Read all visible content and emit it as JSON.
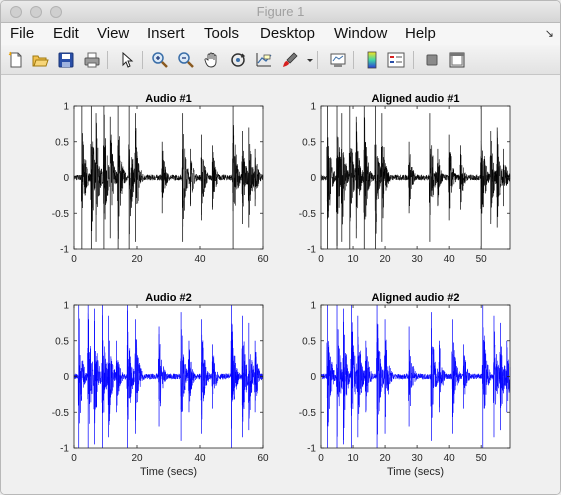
{
  "window": {
    "title": "Figure 1"
  },
  "menu": {
    "file": "File",
    "edit": "Edit",
    "view": "View",
    "insert": "Insert",
    "tools": "Tools",
    "desktop": "Desktop",
    "window": "Window",
    "help": "Help"
  },
  "toolbar": {
    "icons": [
      "new-figure-icon",
      "open-file-icon",
      "save-icon",
      "print-icon",
      "pointer-icon",
      "zoom-in-icon",
      "zoom-out-icon",
      "pan-icon",
      "rotate-3d-icon",
      "data-cursor-icon",
      "brush-icon",
      "dropdown-arrow-icon",
      "link-plot-icon",
      "colorbar-icon",
      "legend-icon",
      "hide-plot-tools-icon",
      "show-plot-tools-icon"
    ]
  },
  "colors": {
    "audio1": "#000000",
    "audio2": "#0000ff"
  },
  "chart_data": [
    {
      "type": "line",
      "title": "Audio #1",
      "xlabel": "",
      "xlim": [
        0,
        60
      ],
      "ylim": [
        -1,
        1
      ],
      "xticks": [
        "0",
        "20",
        "40",
        "60"
      ],
      "yticks": [
        "-1",
        "-0.5",
        "0",
        "0.5",
        "1"
      ],
      "color": "#000000",
      "bursts": [
        {
          "t": 2.5,
          "amp": 1.0
        },
        {
          "t": 5.5,
          "amp": 1.0
        },
        {
          "t": 7.0,
          "amp": 0.9
        },
        {
          "t": 9.5,
          "amp": 1.0
        },
        {
          "t": 11.5,
          "amp": 0.85
        },
        {
          "t": 14.0,
          "amp": 1.0
        },
        {
          "t": 17.5,
          "amp": 1.0
        },
        {
          "t": 19.5,
          "amp": 0.9
        },
        {
          "t": 28.0,
          "amp": 0.5
        },
        {
          "t": 34.5,
          "amp": 0.9
        },
        {
          "t": 37.0,
          "amp": 0.4
        },
        {
          "t": 40.5,
          "amp": 0.6
        },
        {
          "t": 44.0,
          "amp": 0.45
        },
        {
          "t": 50.5,
          "amp": 1.0
        },
        {
          "t": 53.5,
          "amp": 0.65
        },
        {
          "t": 55.5,
          "amp": 0.7
        },
        {
          "t": 57.5,
          "amp": 0.4
        }
      ]
    },
    {
      "type": "line",
      "title": "Aligned audio #1",
      "xlabel": "",
      "xlim": [
        0,
        59
      ],
      "ylim": [
        -1,
        1
      ],
      "xticks": [
        "0",
        "10",
        "20",
        "30",
        "40",
        "50"
      ],
      "yticks": [
        "-1",
        "-0.5",
        "0",
        "0.5",
        "1"
      ],
      "color": "#000000",
      "bursts": [
        {
          "t": 2.0,
          "amp": 1.0
        },
        {
          "t": 5.0,
          "amp": 1.0
        },
        {
          "t": 6.5,
          "amp": 0.9
        },
        {
          "t": 9.0,
          "amp": 1.0
        },
        {
          "t": 11.0,
          "amp": 0.85
        },
        {
          "t": 13.5,
          "amp": 1.0
        },
        {
          "t": 17.0,
          "amp": 1.0
        },
        {
          "t": 19.0,
          "amp": 0.9
        },
        {
          "t": 27.5,
          "amp": 0.5
        },
        {
          "t": 34.0,
          "amp": 0.9
        },
        {
          "t": 36.5,
          "amp": 0.4
        },
        {
          "t": 40.0,
          "amp": 0.6
        },
        {
          "t": 43.5,
          "amp": 0.45
        },
        {
          "t": 50.0,
          "amp": 1.0
        },
        {
          "t": 53.0,
          "amp": 0.65
        },
        {
          "t": 55.0,
          "amp": 0.7
        },
        {
          "t": 57.0,
          "amp": 0.4
        }
      ]
    },
    {
      "type": "line",
      "title": "Audio #2",
      "xlabel": "Time (secs)",
      "xlim": [
        0,
        60
      ],
      "ylim": [
        -1,
        1
      ],
      "xticks": [
        "0",
        "20",
        "40",
        "60"
      ],
      "yticks": [
        "-1",
        "-0.5",
        "0",
        "0.5",
        "1"
      ],
      "color": "#0000ff",
      "bursts": [
        {
          "t": 1.5,
          "amp": 1.0
        },
        {
          "t": 4.5,
          "amp": 1.0
        },
        {
          "t": 6.5,
          "amp": 0.95
        },
        {
          "t": 9.0,
          "amp": 1.0
        },
        {
          "t": 11.0,
          "amp": 0.85
        },
        {
          "t": 13.5,
          "amp": 0.5
        },
        {
          "t": 17.0,
          "amp": 1.0
        },
        {
          "t": 19.5,
          "amp": 0.8
        },
        {
          "t": 27.0,
          "amp": 0.7
        },
        {
          "t": 34.0,
          "amp": 0.9
        },
        {
          "t": 36.5,
          "amp": 0.5
        },
        {
          "t": 40.5,
          "amp": 0.8
        },
        {
          "t": 44.0,
          "amp": 0.45
        },
        {
          "t": 50.0,
          "amp": 1.0
        },
        {
          "t": 53.5,
          "amp": 0.85
        },
        {
          "t": 55.5,
          "amp": 0.75
        },
        {
          "t": 57.5,
          "amp": 0.5
        }
      ]
    },
    {
      "type": "line",
      "title": "Aligned audio #2",
      "xlabel": "Time (secs)",
      "xlim": [
        0,
        59
      ],
      "ylim": [
        -1,
        1
      ],
      "xticks": [
        "0",
        "10",
        "20",
        "30",
        "40",
        "50"
      ],
      "yticks": [
        "-1",
        "-0.5",
        "0",
        "0.5",
        "1"
      ],
      "color": "#0000ff",
      "bursts": [
        {
          "t": 2.0,
          "amp": 1.0
        },
        {
          "t": 5.0,
          "amp": 1.0
        },
        {
          "t": 7.0,
          "amp": 0.95
        },
        {
          "t": 9.5,
          "amp": 1.0
        },
        {
          "t": 11.5,
          "amp": 0.85
        },
        {
          "t": 14.0,
          "amp": 0.5
        },
        {
          "t": 17.5,
          "amp": 1.0
        },
        {
          "t": 20.0,
          "amp": 0.8
        },
        {
          "t": 27.5,
          "amp": 0.7
        },
        {
          "t": 34.5,
          "amp": 0.9
        },
        {
          "t": 37.0,
          "amp": 0.5
        },
        {
          "t": 41.0,
          "amp": 0.8
        },
        {
          "t": 44.5,
          "amp": 0.45
        },
        {
          "t": 50.5,
          "amp": 1.0
        },
        {
          "t": 54.0,
          "amp": 0.85
        },
        {
          "t": 56.0,
          "amp": 0.75
        },
        {
          "t": 58.0,
          "amp": 0.5
        }
      ]
    }
  ]
}
